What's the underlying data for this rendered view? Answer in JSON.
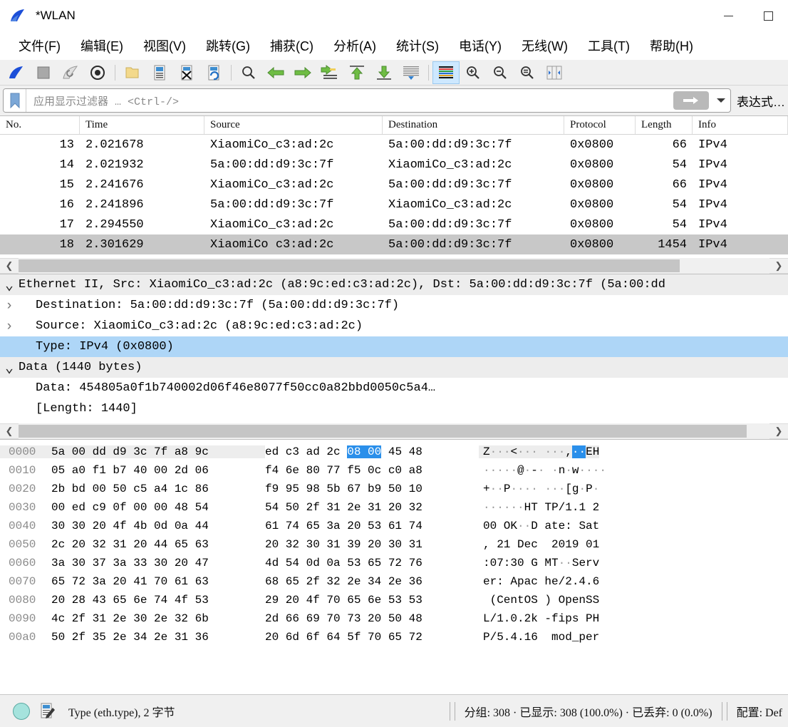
{
  "window": {
    "title": "*WLAN",
    "minimize_label": "minimize",
    "maximize_label": "maximize"
  },
  "menubar": {
    "items": [
      {
        "name": "file",
        "text": "文件(F)",
        "accel": "F"
      },
      {
        "name": "edit",
        "text": "编辑(E)",
        "accel": "E"
      },
      {
        "name": "view",
        "text": "视图(V)",
        "accel": "V"
      },
      {
        "name": "go",
        "text": "跳转(G)",
        "accel": "G"
      },
      {
        "name": "capture",
        "text": "捕获(C)",
        "accel": "C"
      },
      {
        "name": "analyze",
        "text": "分析(A)",
        "accel": "A"
      },
      {
        "name": "statistics",
        "text": "统计(S)",
        "accel": "S"
      },
      {
        "name": "telephony",
        "text": "电话(Y)",
        "accel": "Y"
      },
      {
        "name": "wireless",
        "text": "无线(W)",
        "accel": "W"
      },
      {
        "name": "tools",
        "text": "工具(T)",
        "accel": "T"
      },
      {
        "name": "help",
        "text": "帮助(H)",
        "accel": "H"
      }
    ]
  },
  "toolbar": {
    "buttons": [
      "start-capture-icon",
      "stop-capture-icon",
      "restart-capture-icon",
      "capture-options-icon",
      "sep",
      "open-file-icon",
      "save-file-icon",
      "close-file-icon",
      "reload-file-icon",
      "sep",
      "find-packet-icon",
      "go-back-icon",
      "go-forward-icon",
      "go-to-packet-icon",
      "go-to-first-icon",
      "go-to-last-icon",
      "auto-scroll-icon",
      "sep",
      "colorize-icon",
      "zoom-in-icon",
      "zoom-out-icon",
      "zoom-reset-icon",
      "resize-columns-icon"
    ]
  },
  "filter": {
    "bookmark_icon": "bookmark-icon",
    "value": "",
    "placeholder": "应用显示过滤器 … <Ctrl-/>",
    "apply_label": "→",
    "dropdown_label": "▼",
    "expression_label": "表达式…"
  },
  "packet_list": {
    "columns": [
      "No.",
      "Time",
      "Source",
      "Destination",
      "Protocol",
      "Length",
      "Info"
    ],
    "rows": [
      {
        "no": "13",
        "time": "2.021678",
        "source": "XiaomiCo_c3:ad:2c",
        "destination": "5a:00:dd:d9:3c:7f",
        "protocol": "0x0800",
        "length": "66",
        "info": "IPv4",
        "selected": false
      },
      {
        "no": "14",
        "time": "2.021932",
        "source": "5a:00:dd:d9:3c:7f",
        "destination": "XiaomiCo_c3:ad:2c",
        "protocol": "0x0800",
        "length": "54",
        "info": "IPv4",
        "selected": false
      },
      {
        "no": "15",
        "time": "2.241676",
        "source": "XiaomiCo_c3:ad:2c",
        "destination": "5a:00:dd:d9:3c:7f",
        "protocol": "0x0800",
        "length": "66",
        "info": "IPv4",
        "selected": false
      },
      {
        "no": "16",
        "time": "2.241896",
        "source": "5a:00:dd:d9:3c:7f",
        "destination": "XiaomiCo_c3:ad:2c",
        "protocol": "0x0800",
        "length": "54",
        "info": "IPv4",
        "selected": false
      },
      {
        "no": "17",
        "time": "2.294550",
        "source": "XiaomiCo_c3:ad:2c",
        "destination": "5a:00:dd:d9:3c:7f",
        "protocol": "0x0800",
        "length": "54",
        "info": "IPv4",
        "selected": false
      },
      {
        "no": "18",
        "time": "2.301629",
        "source": "XiaomiCo c3:ad:2c",
        "destination": "5a:00:dd:d9:3c:7f",
        "protocol": "0x0800",
        "length": "1454",
        "info": "IPv4",
        "selected": true
      }
    ]
  },
  "detail_tree": {
    "rows": [
      {
        "twisty": "down",
        "indent": 1,
        "text": "Ethernet II, Src: XiaomiCo_c3:ad:2c (a8:9c:ed:c3:ad:2c), Dst: 5a:00:dd:d9:3c:7f (5a:00:dd",
        "state": "rowhl"
      },
      {
        "twisty": "right",
        "indent": 2,
        "text": "Destination: 5a:00:dd:d9:3c:7f (5a:00:dd:d9:3c:7f)",
        "state": "normal"
      },
      {
        "twisty": "right",
        "indent": 2,
        "text": "Source: XiaomiCo_c3:ad:2c (a8:9c:ed:c3:ad:2c)",
        "state": "normal"
      },
      {
        "twisty": "none",
        "indent": 2,
        "text": "Type: IPv4 (0x0800)",
        "state": "selected"
      },
      {
        "twisty": "down",
        "indent": 1,
        "text": "Data (1440 bytes)",
        "state": "rowhl"
      },
      {
        "twisty": "none",
        "indent": 2,
        "text": "Data: 454805a0f1b740002d06f46e8077f50cc0a82bbd0050c5a4…",
        "state": "normal"
      },
      {
        "twisty": "none",
        "indent": 2,
        "text": "[Length: 1440]",
        "state": "normal"
      }
    ]
  },
  "hex_dump": {
    "rows": [
      {
        "offset": "0000",
        "bytes_left": "5a 00 dd d9 3c 7f a8 9c",
        "bytes_right_pre": "ed c3 ad 2c ",
        "bytes_right_hl": "08 00",
        "bytes_right_post": " 45 48",
        "ascii_pre": "Z···<··· ···,",
        "ascii_hl": "··",
        "ascii_post": "EH",
        "highlight": true
      },
      {
        "offset": "0010",
        "bytes_left": "05 a0 f1 b7 40 00 2d 06",
        "bytes_right_pre": "f4 6e 80 77 f5 0c c0 a8",
        "bytes_right_hl": "",
        "bytes_right_post": "",
        "ascii_pre": "·····@·-· ·n·w····",
        "ascii_hl": "",
        "ascii_post": "",
        "highlight": false
      },
      {
        "offset": "0020",
        "bytes_left": "2b bd 00 50 c5 a4 1c 86",
        "bytes_right_pre": "f9 95 98 5b 67 b9 50 10",
        "bytes_right_hl": "",
        "bytes_right_post": "",
        "ascii_pre": "+··P···· ···[g·P·",
        "ascii_hl": "",
        "ascii_post": "",
        "highlight": false
      },
      {
        "offset": "0030",
        "bytes_left": "00 ed c9 0f 00 00 48 54",
        "bytes_right_pre": "54 50 2f 31 2e 31 20 32",
        "bytes_right_hl": "",
        "bytes_right_post": "",
        "ascii_pre": "······HT TP/1.1 2",
        "ascii_hl": "",
        "ascii_post": "",
        "highlight": false
      },
      {
        "offset": "0040",
        "bytes_left": "30 30 20 4f 4b 0d 0a 44",
        "bytes_right_pre": "61 74 65 3a 20 53 61 74",
        "bytes_right_hl": "",
        "bytes_right_post": "",
        "ascii_pre": "00 OK··D ate: Sat",
        "ascii_hl": "",
        "ascii_post": "",
        "highlight": false
      },
      {
        "offset": "0050",
        "bytes_left": "2c 20 32 31 20 44 65 63",
        "bytes_right_pre": "20 32 30 31 39 20 30 31",
        "bytes_right_hl": "",
        "bytes_right_post": "",
        "ascii_pre": ", 21 Dec  2019 01",
        "ascii_hl": "",
        "ascii_post": "",
        "highlight": false
      },
      {
        "offset": "0060",
        "bytes_left": "3a 30 37 3a 33 30 20 47",
        "bytes_right_pre": "4d 54 0d 0a 53 65 72 76",
        "bytes_right_hl": "",
        "bytes_right_post": "",
        "ascii_pre": ":07:30 G MT··Serv",
        "ascii_hl": "",
        "ascii_post": "",
        "highlight": false
      },
      {
        "offset": "0070",
        "bytes_left": "65 72 3a 20 41 70 61 63",
        "bytes_right_pre": "68 65 2f 32 2e 34 2e 36",
        "bytes_right_hl": "",
        "bytes_right_post": "",
        "ascii_pre": "er: Apac he/2.4.6",
        "ascii_hl": "",
        "ascii_post": "",
        "highlight": false
      },
      {
        "offset": "0080",
        "bytes_left": "20 28 43 65 6e 74 4f 53",
        "bytes_right_pre": "29 20 4f 70 65 6e 53 53",
        "bytes_right_hl": "",
        "bytes_right_post": "",
        "ascii_pre": " (CentOS ) OpenSS",
        "ascii_hl": "",
        "ascii_post": "",
        "highlight": false
      },
      {
        "offset": "0090",
        "bytes_left": "4c 2f 31 2e 30 2e 32 6b",
        "bytes_right_pre": "2d 66 69 70 73 20 50 48",
        "bytes_right_hl": "",
        "bytes_right_post": "",
        "ascii_pre": "L/1.0.2k -fips PH",
        "ascii_hl": "",
        "ascii_post": "",
        "highlight": false
      },
      {
        "offset": "00a0",
        "bytes_left": "50 2f 35 2e 34 2e 31 36",
        "bytes_right_pre": "20 6d 6f 64 5f 70 65 72",
        "bytes_right_hl": "",
        "bytes_right_post": "",
        "ascii_pre": "P/5.4.16  mod_per",
        "ascii_hl": "",
        "ascii_post": "",
        "highlight": false
      }
    ]
  },
  "statusbar": {
    "expert_icon": "expert-info-circle-icon",
    "capture_file_icon": "capture-file-properties-icon",
    "field_text": "Type (eth.type), 2 字节",
    "packets_text": "分组: 308  ·  已显示: 308 (100.0%)  ·  已丢弃: 0 (0.0%)",
    "profile_text": "配置: Def"
  },
  "colors": {
    "accent_blue": "#2a8fea",
    "selection_blue": "#aed6f7",
    "row_selected_gray": "#c8c8c8",
    "toolbar_bg": "#f0f0f0"
  }
}
